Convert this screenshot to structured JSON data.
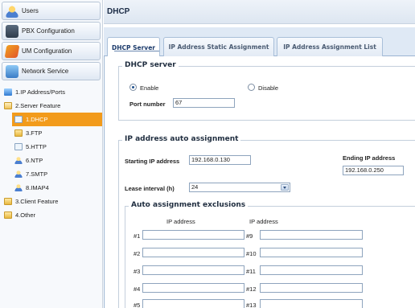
{
  "sidebar": {
    "sections": [
      {
        "label": "Users",
        "icon": "users-icon"
      },
      {
        "label": "PBX Configuration",
        "icon": "pbx-icon"
      },
      {
        "label": "UM Configuration",
        "icon": "um-icon"
      },
      {
        "label": "Network Service",
        "icon": "network-icon"
      }
    ],
    "tree": [
      {
        "label": "1.IP Address/Ports",
        "icon": "network-icon"
      },
      {
        "label": "2.Server Feature",
        "icon": "folder-open-icon"
      },
      {
        "label": "1.DHCP",
        "icon": "document-icon",
        "selected": true
      },
      {
        "label": "3.FTP",
        "icon": "folder-icon"
      },
      {
        "label": "5.HTTP",
        "icon": "document-icon"
      },
      {
        "label": "6.NTP",
        "icon": "user-icon"
      },
      {
        "label": "7.SMTP",
        "icon": "user-icon"
      },
      {
        "label": "8.IMAP4",
        "icon": "user-icon"
      },
      {
        "label": "3.Client Feature",
        "icon": "folder-icon"
      },
      {
        "label": "4.Other",
        "icon": "folder-icon"
      }
    ]
  },
  "header": {
    "title": "DHCP"
  },
  "tabs": [
    {
      "label": "DHCP Server",
      "active": true
    },
    {
      "label": "IP Address Static Assignment",
      "active": false
    },
    {
      "label": "IP Address Assignment List",
      "active": false
    }
  ],
  "dhcp_server": {
    "legend": "DHCP server",
    "enable_label": "Enable",
    "disable_label": "Disable",
    "selected": "Enable",
    "port_label": "Port number",
    "port_value": "67"
  },
  "auto_assignment": {
    "legend": "IP address auto assignment",
    "start_label": "Starting IP address",
    "start_value": "192.168.0.130",
    "end_label": "Ending IP address",
    "end_value": "192.168.0.250",
    "lease_label": "Lease interval (h)",
    "lease_value": "24"
  },
  "exclusions": {
    "legend": "Auto assignment exclusions",
    "col1_header": "IP address",
    "col2_header": "IP address",
    "left_rows": [
      "#1",
      "#2",
      "#3",
      "#4",
      "#5"
    ],
    "right_rows": [
      "#9",
      "#10",
      "#11",
      "#12",
      "#13"
    ]
  },
  "colors": {
    "accent": "#f29b1b",
    "tab_border": "#9bb4d2"
  }
}
